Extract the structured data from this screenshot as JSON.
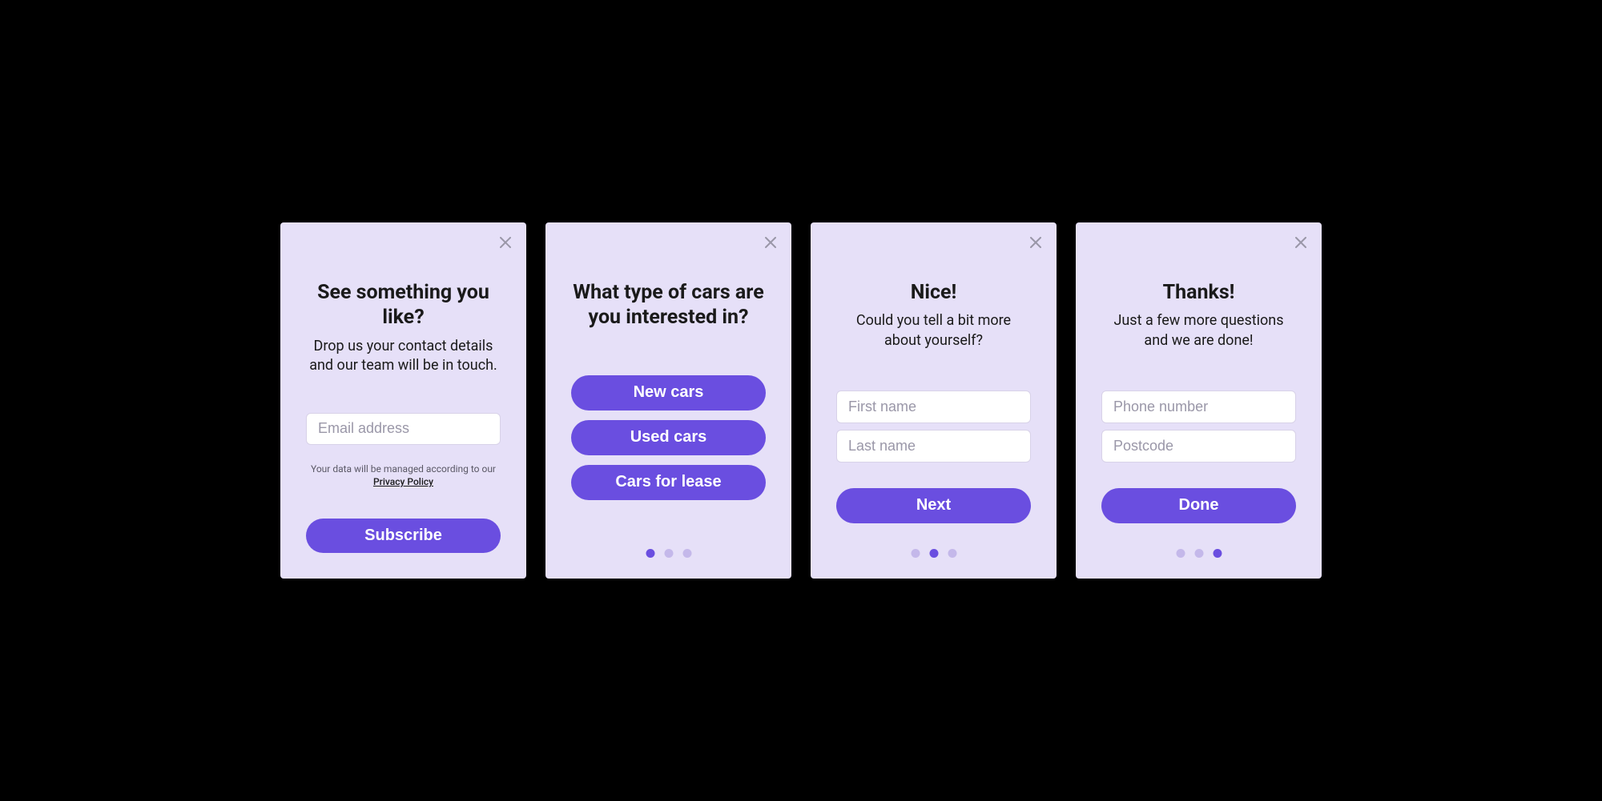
{
  "colors": {
    "accent": "#6a4ee0",
    "card_bg": "#e6e0f8",
    "dot_inactive": "#c4b8ea"
  },
  "card1": {
    "title": "See something you like?",
    "subtitle": "Drop us your contact details and our team will be in touch.",
    "email_placeholder": "Email address",
    "privacy_prefix": "Your data will be managed according to our",
    "privacy_link": "Privacy Policy",
    "subscribe_label": "Subscribe"
  },
  "card2": {
    "title": "What type of cars are you interested in?",
    "options": [
      {
        "label": "New cars"
      },
      {
        "label": "Used cars"
      },
      {
        "label": "Cars for lease"
      }
    ],
    "active_dot": 0
  },
  "card3": {
    "title": "Nice!",
    "subtitle": "Could you tell a bit more about yourself?",
    "first_name_placeholder": "First name",
    "last_name_placeholder": "Last name",
    "next_label": "Next",
    "active_dot": 1
  },
  "card4": {
    "title": "Thanks!",
    "subtitle": "Just a few more questions and we are done!",
    "phone_placeholder": "Phone number",
    "postcode_placeholder": "Postcode",
    "done_label": "Done",
    "active_dot": 2
  }
}
